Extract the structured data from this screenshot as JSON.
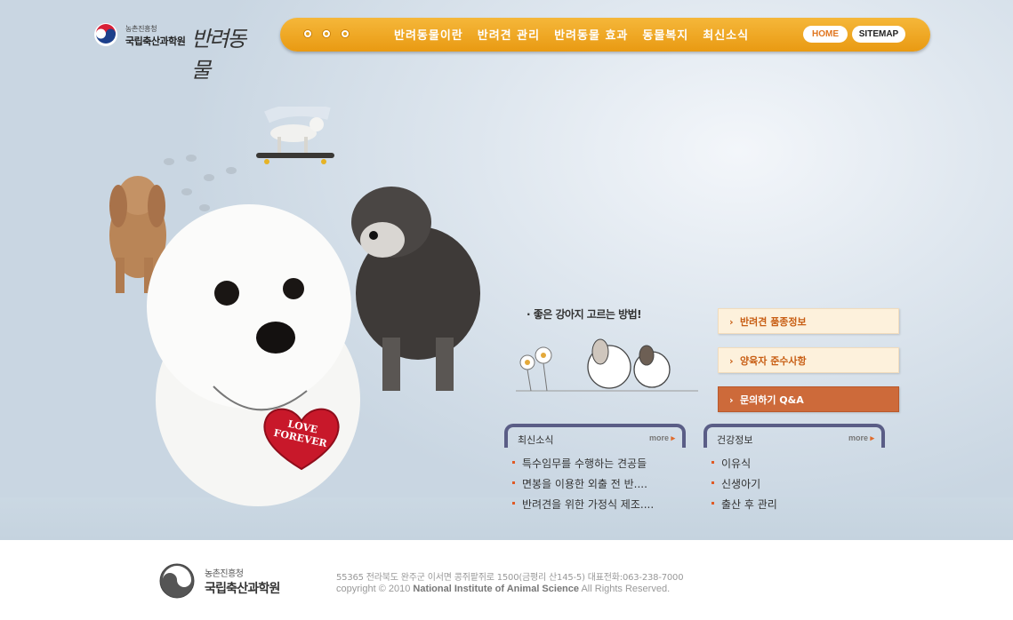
{
  "logo": {
    "org_small": "농촌진흥청",
    "org_name": "국립축산과학원",
    "brand": "반려동물"
  },
  "nav": {
    "items": [
      "반려동물이란",
      "반려견 관리",
      "반려동물 효과",
      "동물복지",
      "최신소식"
    ],
    "home": "HOME",
    "sitemap": "SITEMAP"
  },
  "hero": {
    "tag_line1": "LOVE",
    "tag_line2": "FOREVER"
  },
  "promo": {
    "title": "· 좋은 강아지 고르는 방법!"
  },
  "quick_links": [
    "반려견 품종정보",
    "양육자 준수사항",
    "문의하기 Q&A"
  ],
  "boards": [
    {
      "title": "최신소식",
      "more": "more",
      "items": [
        "특수임무를 수행하는 견공들",
        "면봉을 이용한 외출 전 반....",
        "반려견을 위한 가정식 제조...."
      ]
    },
    {
      "title": "건강정보",
      "more": "more",
      "items": [
        "이유식",
        "신생아기",
        "출산 후 관리"
      ]
    }
  ],
  "footer": {
    "org_small": "농촌진흥청",
    "org_name": "국립축산과학원",
    "address": "55365 전라북도 완주군 이서면 콩쥐팥쥐로 1500(금평리 산145-5) 대표전화:063-238-7000",
    "copy_prefix": "copyright © 2010",
    "copy_org": "National Institute of Animal Science",
    "copy_suffix": "All Rights Reserved."
  },
  "colors": {
    "nav_orange": "#f0a726",
    "accent": "#cd6a3a",
    "board_frame": "#5a5d86"
  },
  "icons": [
    "korea-emblem-icon",
    "arrow-icon",
    "bullet-icon"
  ]
}
